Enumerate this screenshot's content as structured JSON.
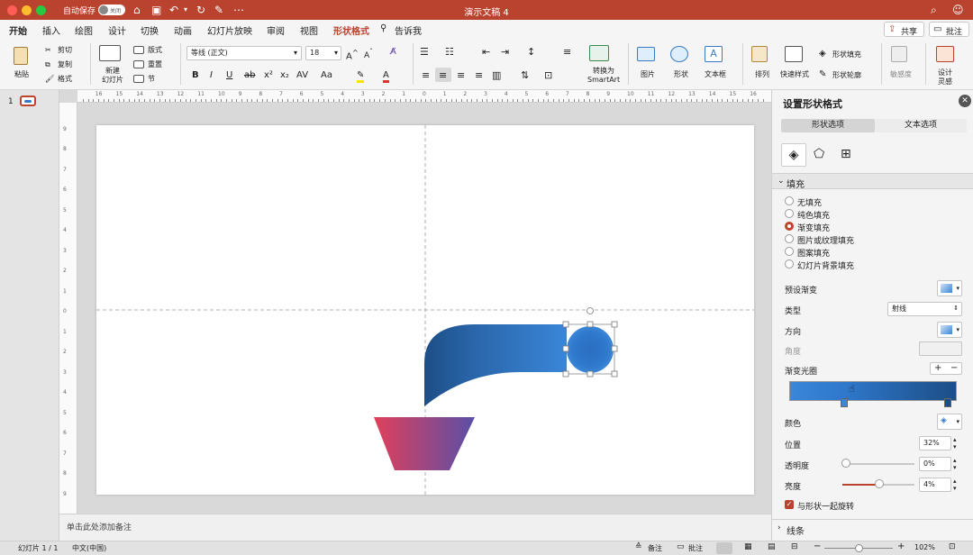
{
  "window": {
    "title": "演示文稿 4",
    "autosave_label": "自动保存",
    "autosave_state": "关闭"
  },
  "tabs": [
    "开始",
    "插入",
    "绘图",
    "设计",
    "切换",
    "动画",
    "幻灯片放映",
    "审阅",
    "视图",
    "形状格式",
    "告诉我"
  ],
  "share_label": "共享",
  "comment_label": "批注",
  "ribbon": {
    "paste": "粘贴",
    "cut": "剪切",
    "copy": "复制",
    "format": "格式",
    "new_slide": "新建\n幻灯片",
    "layout": "版式",
    "reset": "重置",
    "section": "节",
    "font_name": "等线 (正文)",
    "font_size": "18",
    "convert_smartart": "转换为\nSmartArt",
    "picture": "图片",
    "shapes": "形状",
    "textbox": "文本框",
    "arrange": "排列",
    "quick_styles": "快速样式",
    "shape_fill": "形状填充",
    "shape_outline": "形状轮廓",
    "sensitivity": "敏感度",
    "designer": "设计\n灵感"
  },
  "slide_panel": {
    "slide_number": "1"
  },
  "notes_placeholder": "单击此处添加备注",
  "format_pane": {
    "title": "设置形状格式",
    "tabs": [
      "形状选项",
      "文本选项"
    ],
    "fill_section": "填充",
    "fill_options": [
      "无填充",
      "纯色填充",
      "渐变填充",
      "图片或纹理填充",
      "图案填充",
      "幻灯片背景填充"
    ],
    "selected_fill": 2,
    "preset_gradient": "预设渐变",
    "type_label": "类型",
    "type_value": "射线",
    "direction_label": "方向",
    "angle_label": "角度",
    "gradient_stops_label": "渐变光圈",
    "color_label": "颜色",
    "position_label": "位置",
    "position_value": "32%",
    "transparency_label": "透明度",
    "transparency_value": "0%",
    "brightness_label": "亮度",
    "brightness_value": "4%",
    "rotate_with_shape": "与形状一起旋转",
    "line_section": "线条"
  },
  "status": {
    "slide_info": "幻灯片 1 / 1",
    "language": "中文(中国)",
    "notes": "备注",
    "comments": "批注",
    "zoom": "102%"
  },
  "colors": {
    "accent": "#b9432e",
    "gradient_light": "#3a86d8",
    "gradient_dark": "#1c4e86",
    "trap_left": "#e0405a",
    "trap_right": "#5a4fa8"
  }
}
